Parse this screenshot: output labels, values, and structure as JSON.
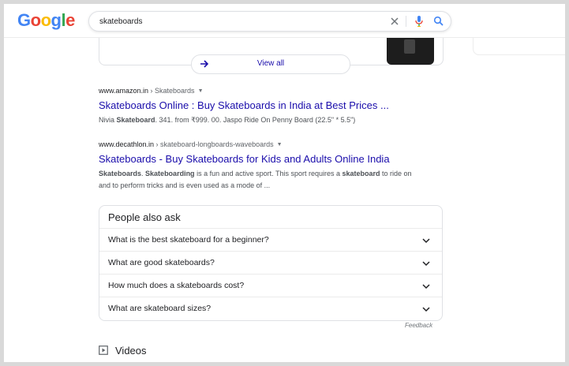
{
  "logo": {
    "letters": [
      "G",
      "o",
      "o",
      "g",
      "l",
      "e"
    ],
    "colors": [
      "#4285f4",
      "#ea4335",
      "#fbbc05",
      "#4285f4",
      "#34a853",
      "#ea4335"
    ]
  },
  "search": {
    "query": "skateboards"
  },
  "top_card": {
    "view_all_label": "View all"
  },
  "results": [
    {
      "domain": "www.amazon.in",
      "path": " › Skateboards",
      "title": "Skateboards Online : Buy Skateboards in India at Best Prices ...",
      "snippet_parts": [
        {
          "text": "Nivia ",
          "bold": false
        },
        {
          "text": "Skateboard",
          "bold": true
        },
        {
          "text": ". 341. from ₹999. 00. Jaspo Ride On Penny Board (22.5\" * 5.5\")",
          "bold": false
        }
      ]
    },
    {
      "domain": "www.decathlon.in",
      "path": " › skateboard-longboards-waveboards",
      "title": "Skateboards - Buy Skateboards for Kids and Adults Online India",
      "snippet_parts": [
        {
          "text": "Skateboards",
          "bold": true
        },
        {
          "text": ". ",
          "bold": false
        },
        {
          "text": "Skateboarding",
          "bold": true
        },
        {
          "text": " is a fun and active sport. This sport requires a ",
          "bold": false
        },
        {
          "text": "skateboard",
          "bold": true
        },
        {
          "text": " to ride on and to perform tricks and is even used as a mode of ...",
          "bold": false
        }
      ]
    }
  ],
  "people_also_ask": {
    "title": "People also ask",
    "questions": [
      "What is the best skateboard for a beginner?",
      "What are good skateboards?",
      "How much does a skateboards cost?",
      "What are skateboard sizes?"
    ]
  },
  "feedback_label": "Feedback",
  "videos_label": "Videos",
  "colors": {
    "link": "#1a0dab",
    "text": "#202124",
    "snippet": "#4d5156",
    "border": "#dfe1e5"
  }
}
